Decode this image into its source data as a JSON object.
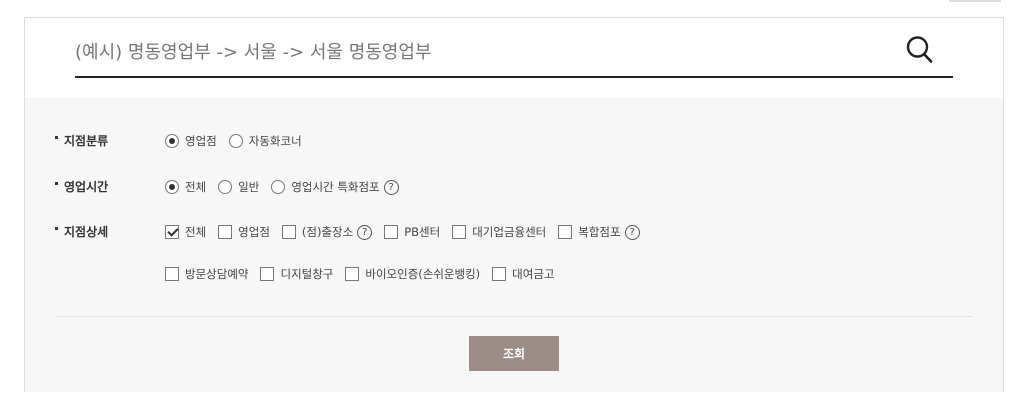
{
  "search": {
    "placeholder": "(예시) 명동영업부 -> 서울 -> 서울 명동영업부",
    "button_icon": "search-icon"
  },
  "filters": {
    "branch_type": {
      "label": "지점분류",
      "options": [
        {
          "label": "영업점",
          "selected": true
        },
        {
          "label": "자동화코너",
          "selected": false
        }
      ]
    },
    "business_hours": {
      "label": "영업시간",
      "options": [
        {
          "label": "전체",
          "selected": true
        },
        {
          "label": "일반",
          "selected": false
        },
        {
          "label": "영업시간 특화점포",
          "selected": false,
          "help": "?"
        }
      ]
    },
    "branch_detail": {
      "label": "지점상세",
      "options": [
        {
          "label": "전체",
          "checked": true
        },
        {
          "label": "영업점",
          "checked": false
        },
        {
          "label": "(점)출장소",
          "checked": false,
          "help": "?"
        },
        {
          "label": "PB센터",
          "checked": false
        },
        {
          "label": "대기업금융센터",
          "checked": false
        },
        {
          "label": "복합점포",
          "checked": false,
          "help": "?"
        },
        {
          "label": "방문상담예약",
          "checked": false
        },
        {
          "label": "디지털창구",
          "checked": false
        },
        {
          "label": "바이오인증(손쉬운뱅킹)",
          "checked": false
        },
        {
          "label": "대여금고",
          "checked": false
        }
      ]
    }
  },
  "submit_label": "조회",
  "colors": {
    "submit_bg": "#9b8c86",
    "filter_bg": "#f7f7f7",
    "underline": "#222222"
  }
}
